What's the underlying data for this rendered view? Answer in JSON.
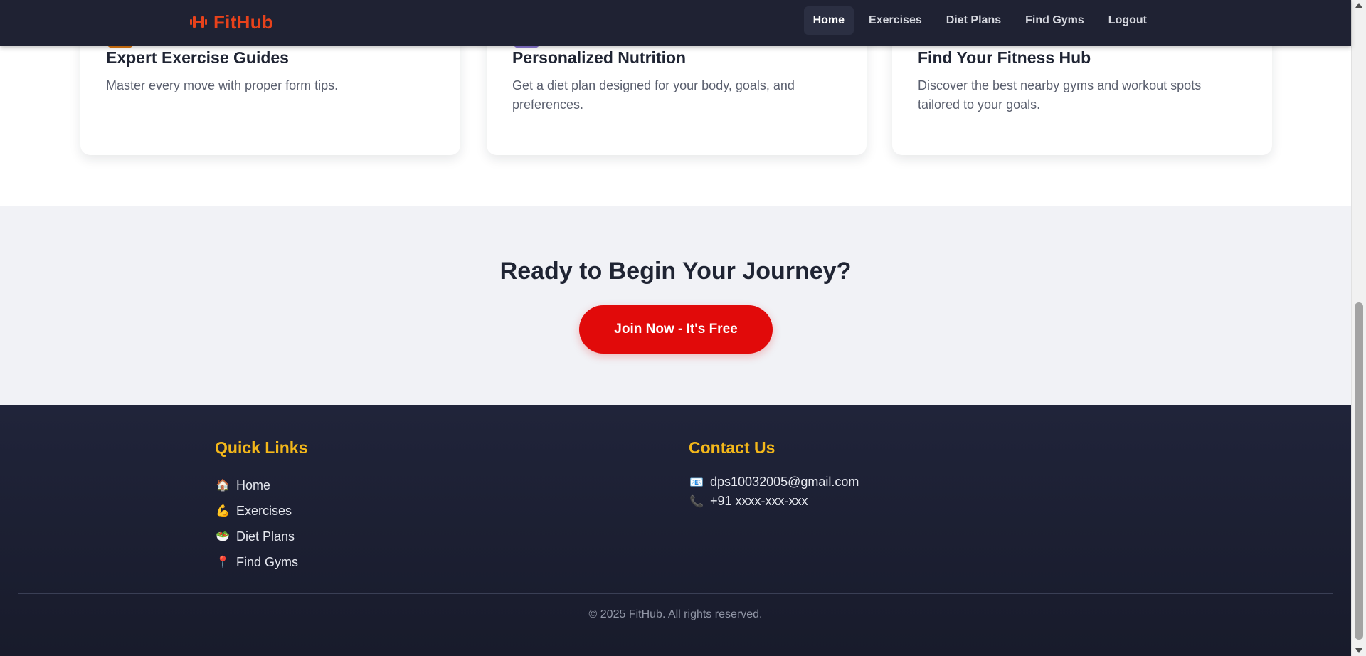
{
  "nav": {
    "brand": "FitHub",
    "links": [
      "Home",
      "Exercises",
      "Diet Plans",
      "Find Gyms",
      "Logout"
    ],
    "active": "Home"
  },
  "features": [
    {
      "title": "Expert Exercise Guides",
      "description": "Master every move with proper form tips.",
      "icon": "dumbbell-icon",
      "icon_color": "#e07a10"
    },
    {
      "title": "Personalized Nutrition",
      "description": "Get a diet plan designed for your body, goals, and preferences.",
      "icon": "nutrition-icon",
      "icon_color": "#8c7ad8"
    },
    {
      "title": "Find Your Fitness Hub",
      "description": "Discover the best nearby gyms and workout spots tailored to your goals.",
      "icon": "location-icon",
      "icon_color": "#8a2f4c"
    }
  ],
  "cta": {
    "heading": "Ready to Begin Your Journey?",
    "button": "Join Now - It's Free"
  },
  "footer": {
    "quick_links_title": "Quick Links",
    "quick_links": [
      {
        "emoji": "🏠",
        "label": "Home"
      },
      {
        "emoji": "💪",
        "label": "Exercises"
      },
      {
        "emoji": "🥗",
        "label": "Diet Plans"
      },
      {
        "emoji": "📍",
        "label": "Find Gyms"
      }
    ],
    "contact_title": "Contact Us",
    "contacts": [
      {
        "emoji": "📧",
        "label": "dps10032005@gmail.com"
      },
      {
        "emoji": "📞",
        "label": "+91 xxxx-xxx-xxx"
      }
    ],
    "copyright": "© 2025 FitHub. All rights reserved."
  },
  "colors": {
    "nav_bg": "#1f2233",
    "brand": "#e8421b",
    "accent_yellow": "#f3b71a",
    "cta_red": "#e10a0a",
    "cta_bg": "#f1f2f6"
  }
}
